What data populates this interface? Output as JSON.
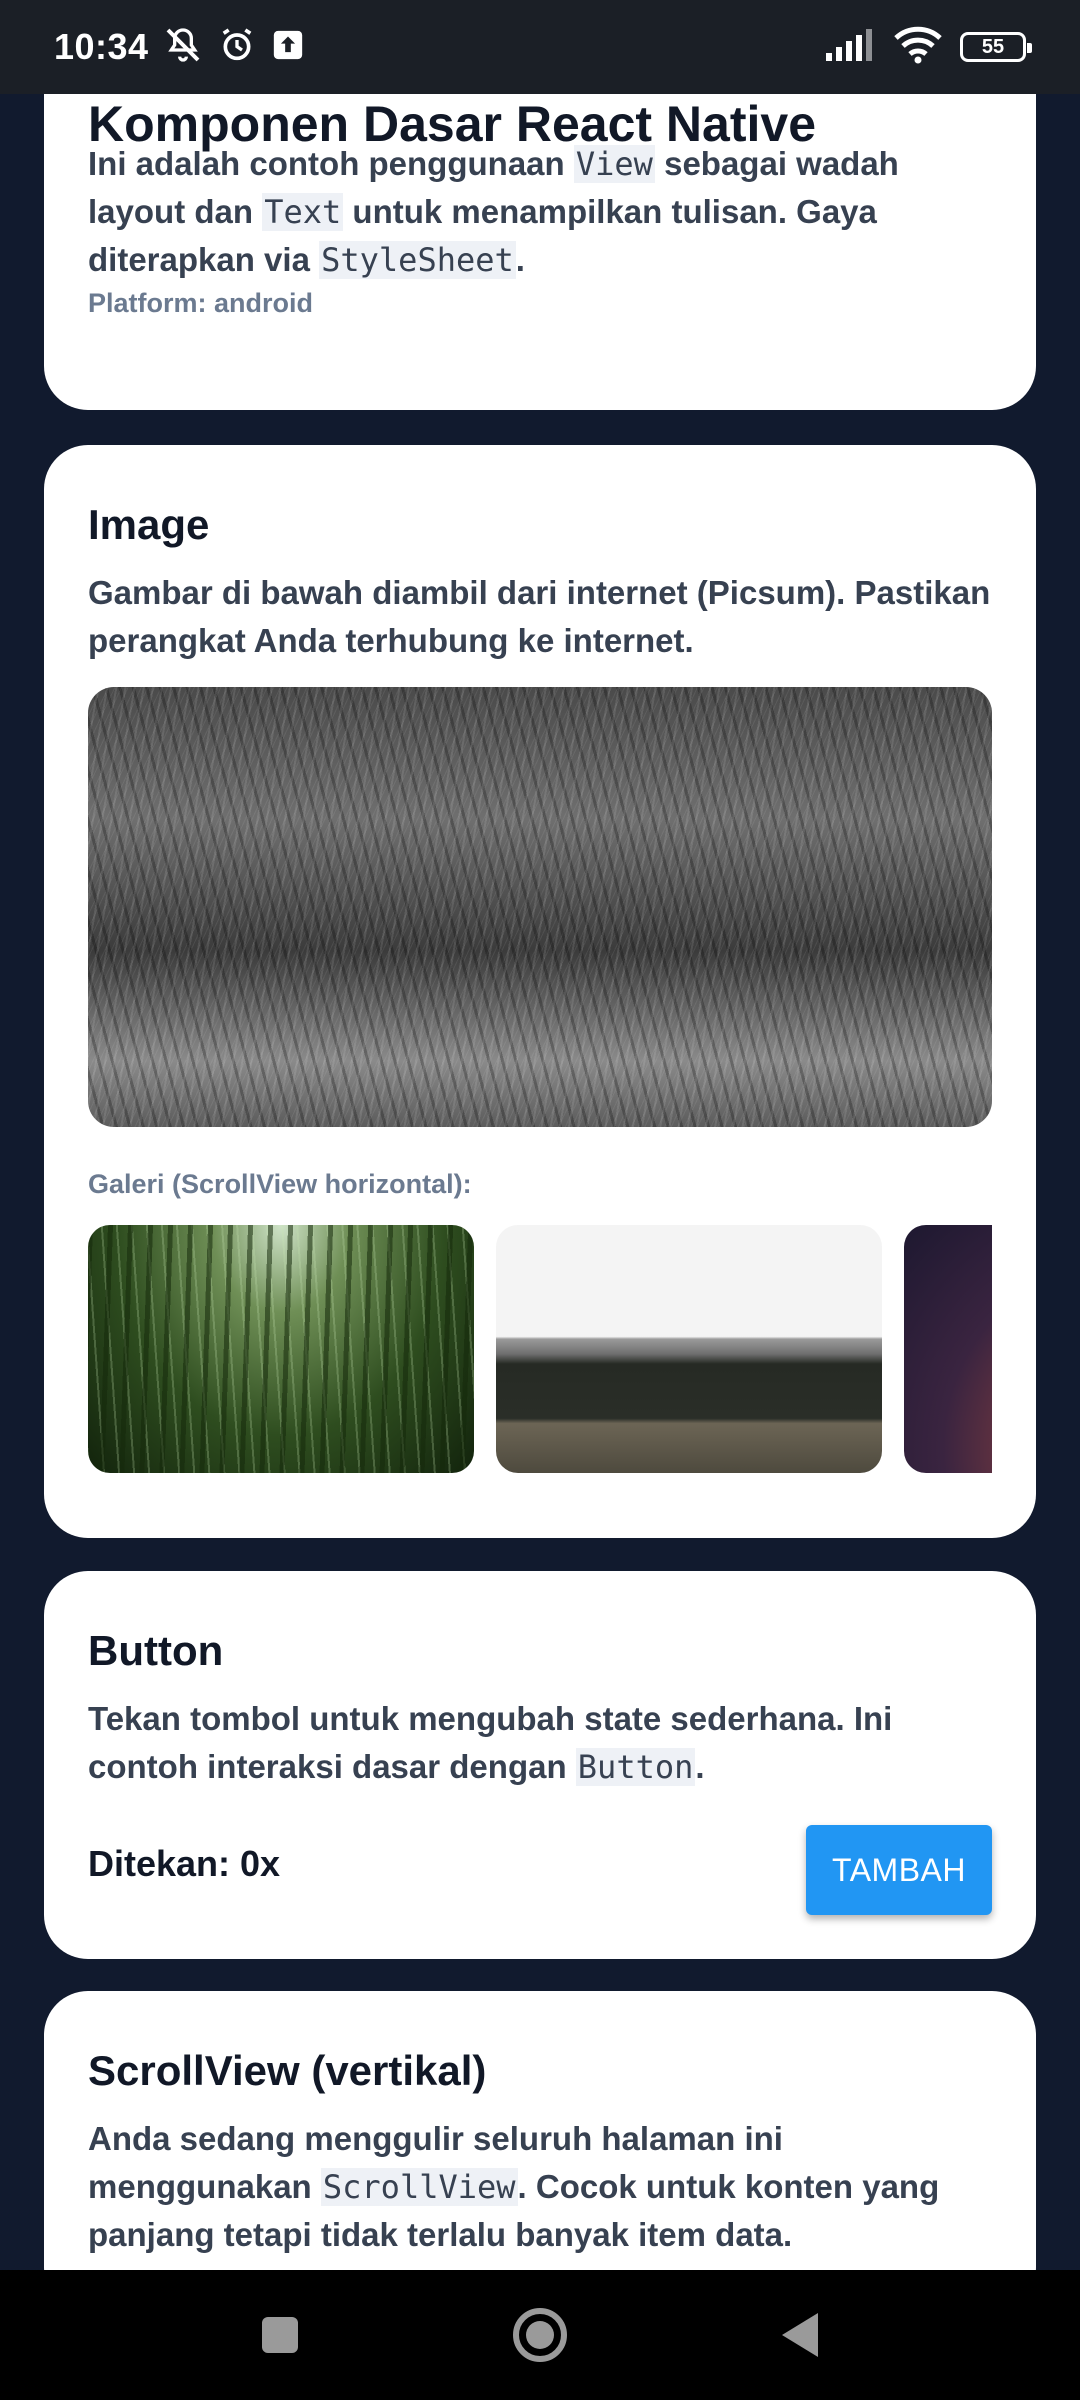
{
  "status_bar": {
    "time": "10:34",
    "battery": "55",
    "icons": [
      "mute-icon",
      "alarm-icon",
      "upload-icon",
      "signal-icon",
      "wifi-icon",
      "battery-icon"
    ]
  },
  "cards": {
    "basics": {
      "title": "Komponen Dasar React Native",
      "text_1": "Ini adalah contoh penggunaan ",
      "code_1": "View",
      "text_2": " sebagai wadah layout dan ",
      "code_2": "Text",
      "text_3": " untuk menampilkan tulisan. Gaya diterapkan via ",
      "code_3": "StyleSheet",
      "text_4": ".",
      "platform": "Platform: android"
    },
    "image": {
      "title": "Image",
      "text": "Gambar di bawah diambil dari internet (Picsum). Pastikan perangkat Anda terhubung ke internet.",
      "gallery_label": "Galeri (ScrollView horizontal):"
    },
    "button": {
      "title": "Button",
      "text_1": "Tekan tombol untuk mengubah state sederhana. Ini contoh interaksi dasar dengan ",
      "code_1": "Button",
      "text_2": ".",
      "counter": "Ditekan: 0x",
      "button_label": "TAMBAH"
    },
    "scroll": {
      "title": "ScrollView (vertikal)",
      "text_1": "Anda sedang menggulir seluruh halaman ini menggunakan ",
      "code_1": "ScrollView",
      "text_2": ". Cocok untuk konten yang panjang tetapi tidak terlalu banyak item data."
    }
  },
  "nav_bar": {
    "icons": [
      "recents-icon",
      "home-icon",
      "back-icon"
    ]
  },
  "colors": {
    "background": "#111a2e",
    "card": "#ffffff",
    "accent": "#2196f3"
  }
}
